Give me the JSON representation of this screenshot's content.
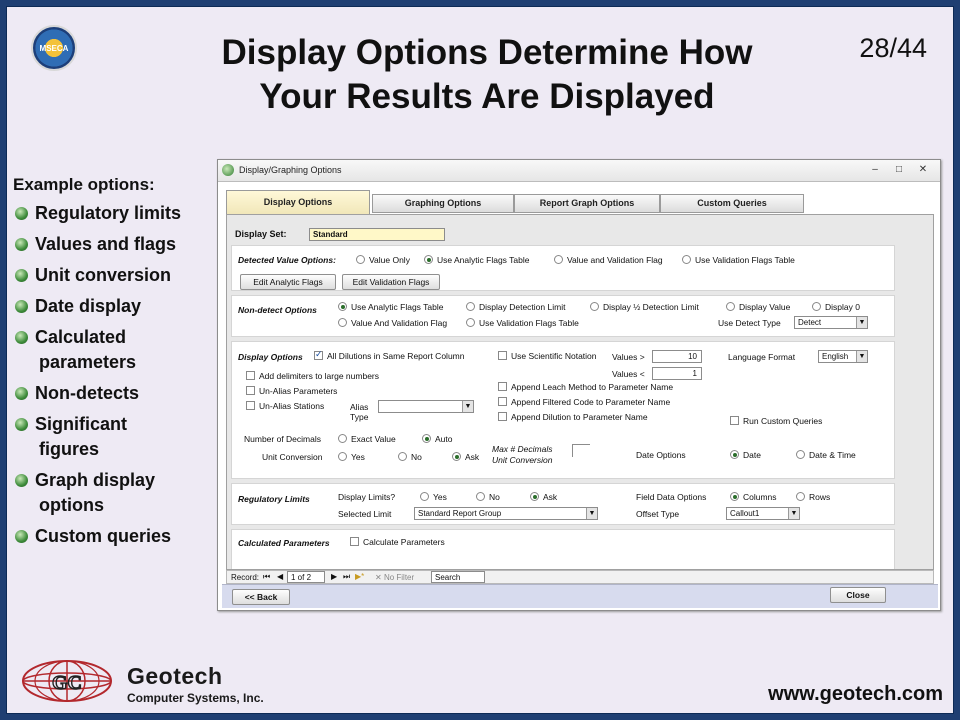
{
  "slide": {
    "title_line1": "Display Options Determine How",
    "title_line2": "Your Results Are Displayed",
    "page_number": "28/44",
    "logo_text": "MSECA",
    "company_name": "Geotech",
    "company_sub": "Computer Systems, Inc.",
    "url": "www.geotech.com"
  },
  "bullets": {
    "heading": "Example options:",
    "items": [
      {
        "line1": "Regulatory limits",
        "line2": ""
      },
      {
        "line1": "Values and flags",
        "line2": ""
      },
      {
        "line1": "Unit conversion",
        "line2": ""
      },
      {
        "line1": "Date display",
        "line2": ""
      },
      {
        "line1": "Calculated",
        "line2": "parameters"
      },
      {
        "line1": "Non-detects",
        "line2": ""
      },
      {
        "line1": "Significant",
        "line2": "figures"
      },
      {
        "line1": "Graph display",
        "line2": "options"
      },
      {
        "line1": "Custom queries",
        "line2": ""
      }
    ]
  },
  "window": {
    "title": "Display/Graphing Options",
    "tabs": [
      "Display Options",
      "Graphing Options",
      "Report Graph Options",
      "Custom Queries"
    ],
    "display_set_label": "Display Set:",
    "display_set_value": "Standard",
    "detected": {
      "label": "Detected Value Options:",
      "options": [
        "Value Only",
        "Use Analytic Flags Table",
        "Value and Validation Flag",
        "Use Validation Flags Table"
      ],
      "selected": "Use Analytic Flags Table",
      "edit_analytic": "Edit Analytic Flags",
      "edit_validation": "Edit Validation Flags"
    },
    "nondetect": {
      "label": "Non-detect Options",
      "options_row1": [
        "Use Analytic Flags Table",
        "Display Detection Limit",
        "Display ½ Detection Limit",
        "Display Value",
        "Display 0"
      ],
      "options_row2": [
        "Value And Validation Flag",
        "Use Validation Flags Table"
      ],
      "selected": "Use Analytic Flags Table",
      "use_detect_type_label": "Use Detect Type",
      "use_detect_type_value": "Detect"
    },
    "display": {
      "label": "Display Options",
      "all_dilutions": "All Dilutions in Same Report Column",
      "sci_notation": "Use Scientific Notation",
      "values_gt_label": "Values >",
      "values_gt": "10",
      "values_lt_label": "Values <",
      "values_lt": "1",
      "language_label": "Language Format",
      "language_value": "English",
      "add_delimiters": "Add delimiters to large numbers",
      "unalias_params": "Un-Alias Parameters",
      "unalias_stations": "Un-Alias Stations",
      "alias_type_l1": "Alias",
      "alias_type_l2": "Type",
      "append_leach": "Append Leach Method to  Parameter Name",
      "append_filtered": "Append Filtered Code to  Parameter Name",
      "append_dilution": "Append Dilution to  Parameter Name",
      "run_custom": "Run Custom Queries",
      "decimals_label": "Number of Decimals",
      "decimals_options": [
        "Exact Value",
        "Auto"
      ],
      "decimals_selected": "Auto",
      "unit_conv_label": "Unit Conversion",
      "unit_conv_options": [
        "Yes",
        "No",
        "Ask"
      ],
      "unit_conv_selected": "Ask",
      "max_dec_l1": "Max # Decimals",
      "max_dec_l2": "Unit Conversion",
      "date_options_label": "Date Options",
      "date_options": [
        "Date",
        "Date & Time"
      ],
      "date_selected": "Date"
    },
    "regulatory": {
      "label": "Regulatory Limits",
      "display_limits_label": "Display Limits?",
      "display_limits_options": [
        "Yes",
        "No",
        "Ask"
      ],
      "display_limits_selected": "Ask",
      "selected_limit_label": "Selected Limit",
      "selected_limit_value": "Standard Report Group",
      "field_data_label": "Field Data Options",
      "field_data_options": [
        "Columns",
        "Rows"
      ],
      "field_data_selected": "Columns",
      "offset_type_label": "Offset Type",
      "offset_type_value": "Callout1"
    },
    "calculated": {
      "label": "Calculated Parameters",
      "checkbox": "Calculate Parameters"
    },
    "record": {
      "label": "Record:",
      "position": "1 of 2",
      "no_filter": "No Filter",
      "search": "Search"
    },
    "back_button": "<< Back",
    "close_button": "Close"
  }
}
